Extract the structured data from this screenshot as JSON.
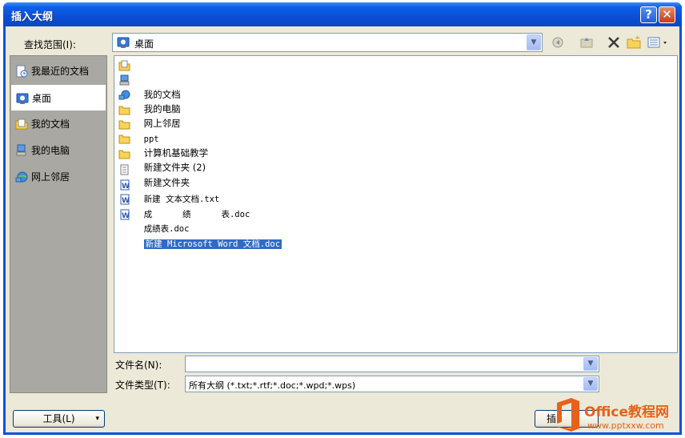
{
  "window": {
    "title": "插入大纲",
    "help_symbol": "?",
    "close_symbol": "✕"
  },
  "lookin": {
    "label": "查找范围(I):",
    "value": "桌面",
    "icon": "desktop-icon"
  },
  "toolbar": {
    "items": [
      {
        "name": "back-icon",
        "symbol": "◀"
      },
      {
        "name": "up-folder-icon",
        "symbol": "⬆"
      },
      {
        "name": "delete-icon",
        "symbol": "✕"
      },
      {
        "name": "new-folder-icon",
        "symbol": "📁"
      },
      {
        "name": "views-icon",
        "symbol": "▦"
      }
    ]
  },
  "places": [
    {
      "label": "我最近的文档",
      "icon": "recent-documents-icon",
      "selected": false
    },
    {
      "label": "桌面",
      "icon": "desktop-icon",
      "selected": true
    },
    {
      "label": "我的文档",
      "icon": "my-documents-icon",
      "selected": false
    },
    {
      "label": "我的电脑",
      "icon": "my-computer-icon",
      "selected": false
    },
    {
      "label": "网上邻居",
      "icon": "network-places-icon",
      "selected": false
    }
  ],
  "files": [
    {
      "name": "我的文档",
      "icon": "my-documents-icon"
    },
    {
      "name": "我的电脑",
      "icon": "my-computer-icon"
    },
    {
      "name": "网上邻居",
      "icon": "network-places-icon"
    },
    {
      "name": "ppt",
      "icon": "folder-icon"
    },
    {
      "name": "计算机基础教学",
      "icon": "folder-icon"
    },
    {
      "name": "新建文件夹 (2)",
      "icon": "folder-icon"
    },
    {
      "name": "新建文件夹",
      "icon": "folder-icon"
    },
    {
      "name": "新建 文本文档.txt",
      "icon": "text-file-icon"
    },
    {
      "name": "成      绩      表.doc",
      "icon": "word-doc-icon"
    },
    {
      "name": "成绩表.doc",
      "icon": "word-doc-icon"
    },
    {
      "name": "新建 Microsoft Word 文档.doc",
      "icon": "word-doc-icon",
      "selected": true
    }
  ],
  "filename": {
    "label": "文件名(N):",
    "value": ""
  },
  "filetype": {
    "label": "文件类型(T):",
    "value": "所有大纲 (*.txt;*.rtf;*.doc;*.wpd;*.wps)"
  },
  "buttons": {
    "tools": "工具(L)",
    "tools_caret": "▾",
    "insert_partial": "插"
  },
  "watermark": {
    "brand": "Office教程网",
    "url": "www.pptxxw.com"
  },
  "colors": {
    "titlebar": "#0a4fd6",
    "selection": "#316ac5",
    "watermark": "#e8611a"
  }
}
